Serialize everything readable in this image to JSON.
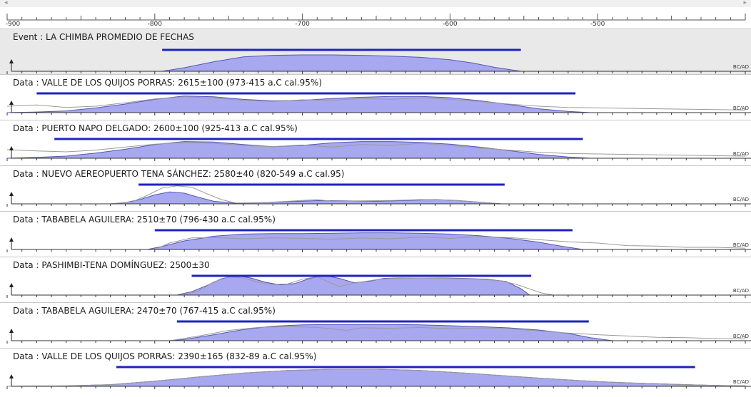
{
  "scrollbar": {
    "left_arrow": "◂",
    "right_arrow": "▸"
  },
  "axis": {
    "min": -900,
    "max": -400,
    "labels": [
      {
        "value": -900,
        "text": "-900"
      },
      {
        "value": -800,
        "text": "-800"
      },
      {
        "value": -700,
        "text": "-700"
      },
      {
        "value": -600,
        "text": "-600"
      },
      {
        "value": -500,
        "text": "-500"
      }
    ],
    "unit_label": "BC/AD"
  },
  "colors": {
    "range_bar": "#1f22c0",
    "posterior_fill": "#a7a8ef",
    "posterior_stroke": "#5656b3",
    "prior_line": "#9a9a9a",
    "event_bg": "#e9e9e9"
  },
  "panels": [
    {
      "label": "Event : LA CHIMBA PROMEDIO DE FECHAS",
      "range": [
        -795,
        -552
      ],
      "posterior": [
        [
          -795,
          0.0
        ],
        [
          -780,
          0.18
        ],
        [
          -760,
          0.48
        ],
        [
          -740,
          0.72
        ],
        [
          -720,
          0.8
        ],
        [
          -700,
          0.82
        ],
        [
          -680,
          0.82
        ],
        [
          -660,
          0.8
        ],
        [
          -640,
          0.76
        ],
        [
          -620,
          0.7
        ],
        [
          -600,
          0.58
        ],
        [
          -585,
          0.42
        ],
        [
          -570,
          0.2
        ],
        [
          -552,
          0.0
        ]
      ],
      "prior": [
        [
          -900,
          0.0
        ],
        [
          -800,
          0.0
        ],
        [
          -560,
          0.0
        ],
        [
          -540,
          0.0
        ],
        [
          -500,
          0.0
        ],
        [
          -400,
          0.0
        ]
      ]
    },
    {
      "label": "Data : VALLE DE LOS QUIJOS PORRAS: 2615±100 (973-415 a.C cal.95%)",
      "range": [
        -880,
        -515
      ],
      "posterior": [
        [
          -900,
          0.0
        ],
        [
          -880,
          0.03
        ],
        [
          -860,
          0.08
        ],
        [
          -840,
          0.22
        ],
        [
          -820,
          0.4
        ],
        [
          -800,
          0.62
        ],
        [
          -780,
          0.78
        ],
        [
          -760,
          0.74
        ],
        [
          -740,
          0.62
        ],
        [
          -720,
          0.55
        ],
        [
          -700,
          0.58
        ],
        [
          -680,
          0.66
        ],
        [
          -660,
          0.72
        ],
        [
          -640,
          0.76
        ],
        [
          -620,
          0.76
        ],
        [
          -600,
          0.7
        ],
        [
          -580,
          0.56
        ],
        [
          -560,
          0.38
        ],
        [
          -540,
          0.18
        ],
        [
          -520,
          0.06
        ],
        [
          -505,
          0.0
        ]
      ],
      "prior": [
        [
          -900,
          0.3
        ],
        [
          -880,
          0.36
        ],
        [
          -860,
          0.24
        ],
        [
          -840,
          0.3
        ],
        [
          -820,
          0.46
        ],
        [
          -800,
          0.64
        ],
        [
          -780,
          0.74
        ],
        [
          -760,
          0.68
        ],
        [
          -740,
          0.58
        ],
        [
          -720,
          0.52
        ],
        [
          -700,
          0.6
        ],
        [
          -680,
          0.58
        ],
        [
          -660,
          0.66
        ],
        [
          -640,
          0.62
        ],
        [
          -620,
          0.7
        ],
        [
          -600,
          0.62
        ],
        [
          -580,
          0.52
        ],
        [
          -560,
          0.4
        ],
        [
          -540,
          0.3
        ],
        [
          -520,
          0.24
        ],
        [
          -500,
          0.22
        ],
        [
          -460,
          0.18
        ],
        [
          -420,
          0.14
        ],
        [
          -400,
          0.12
        ]
      ]
    },
    {
      "label": "Data : PUERTO NAPO DELGADO: 2600±100 (925-413 a.C cal.95%)",
      "range": [
        -868,
        -510
      ],
      "posterior": [
        [
          -900,
          0.0
        ],
        [
          -880,
          0.04
        ],
        [
          -860,
          0.1
        ],
        [
          -840,
          0.24
        ],
        [
          -820,
          0.42
        ],
        [
          -800,
          0.64
        ],
        [
          -780,
          0.78
        ],
        [
          -760,
          0.76
        ],
        [
          -740,
          0.64
        ],
        [
          -720,
          0.54
        ],
        [
          -700,
          0.6
        ],
        [
          -680,
          0.72
        ],
        [
          -660,
          0.78
        ],
        [
          -640,
          0.78
        ],
        [
          -620,
          0.74
        ],
        [
          -600,
          0.66
        ],
        [
          -580,
          0.52
        ],
        [
          -560,
          0.36
        ],
        [
          -540,
          0.18
        ],
        [
          -520,
          0.06
        ],
        [
          -505,
          0.0
        ]
      ],
      "prior": [
        [
          -900,
          0.4
        ],
        [
          -880,
          0.34
        ],
        [
          -860,
          0.3
        ],
        [
          -840,
          0.38
        ],
        [
          -820,
          0.52
        ],
        [
          -800,
          0.66
        ],
        [
          -780,
          0.74
        ],
        [
          -760,
          0.7
        ],
        [
          -740,
          0.6
        ],
        [
          -720,
          0.54
        ],
        [
          -700,
          0.62
        ],
        [
          -680,
          0.52
        ],
        [
          -660,
          0.64
        ],
        [
          -640,
          0.6
        ],
        [
          -620,
          0.7
        ],
        [
          -600,
          0.6
        ],
        [
          -580,
          0.48
        ],
        [
          -560,
          0.38
        ],
        [
          -540,
          0.28
        ],
        [
          -520,
          0.22
        ],
        [
          -500,
          0.2
        ],
        [
          -460,
          0.16
        ],
        [
          -420,
          0.12
        ],
        [
          -400,
          0.1
        ]
      ]
    },
    {
      "label": "Data : NUEVO AEREOPUERTO TENA SÁNCHEZ: 2580±40 (820-549 a.C cal.95)",
      "range": [
        -811,
        -563
      ],
      "posterior": [
        [
          -830,
          0.0
        ],
        [
          -820,
          0.06
        ],
        [
          -810,
          0.2
        ],
        [
          -800,
          0.42
        ],
        [
          -790,
          0.56
        ],
        [
          -780,
          0.5
        ],
        [
          -770,
          0.3
        ],
        [
          -760,
          0.12
        ],
        [
          -745,
          0.03
        ],
        [
          -730,
          0.05
        ],
        [
          -710,
          0.1
        ],
        [
          -690,
          0.15
        ],
        [
          -670,
          0.14
        ],
        [
          -650,
          0.12
        ],
        [
          -630,
          0.16
        ],
        [
          -610,
          0.2
        ],
        [
          -595,
          0.16
        ],
        [
          -580,
          0.08
        ],
        [
          -565,
          0.0
        ]
      ],
      "prior": [
        [
          -830,
          0.0
        ],
        [
          -815,
          0.1
        ],
        [
          -805,
          0.4
        ],
        [
          -795,
          0.74
        ],
        [
          -785,
          0.84
        ],
        [
          -775,
          0.78
        ],
        [
          -765,
          0.48
        ],
        [
          -755,
          0.2
        ],
        [
          -745,
          0.04
        ],
        [
          -730,
          0.04
        ],
        [
          -710,
          0.12
        ],
        [
          -690,
          0.2
        ],
        [
          -680,
          0.12
        ],
        [
          -660,
          0.14
        ],
        [
          -640,
          0.16
        ],
        [
          -620,
          0.2
        ],
        [
          -600,
          0.18
        ],
        [
          -585,
          0.1
        ],
        [
          -565,
          0.0
        ]
      ]
    },
    {
      "label": "Data : TABABELA AGUILERA: 2510±70 (796-430 a.C cal.95%)",
      "range": [
        -800,
        -517
      ],
      "posterior": [
        [
          -805,
          0.0
        ],
        [
          -795,
          0.14
        ],
        [
          -780,
          0.4
        ],
        [
          -760,
          0.62
        ],
        [
          -740,
          0.72
        ],
        [
          -720,
          0.74
        ],
        [
          -700,
          0.74
        ],
        [
          -680,
          0.76
        ],
        [
          -660,
          0.78
        ],
        [
          -640,
          0.78
        ],
        [
          -620,
          0.76
        ],
        [
          -600,
          0.72
        ],
        [
          -580,
          0.64
        ],
        [
          -560,
          0.52
        ],
        [
          -540,
          0.34
        ],
        [
          -525,
          0.16
        ],
        [
          -510,
          0.0
        ]
      ],
      "prior": [
        [
          -800,
          0.0
        ],
        [
          -790,
          0.3
        ],
        [
          -775,
          0.54
        ],
        [
          -760,
          0.56
        ],
        [
          -740,
          0.5
        ],
        [
          -720,
          0.54
        ],
        [
          -700,
          0.52
        ],
        [
          -680,
          0.48
        ],
        [
          -660,
          0.54
        ],
        [
          -640,
          0.5
        ],
        [
          -620,
          0.58
        ],
        [
          -600,
          0.52
        ],
        [
          -580,
          0.6
        ],
        [
          -560,
          0.56
        ],
        [
          -540,
          0.46
        ],
        [
          -520,
          0.36
        ],
        [
          -500,
          0.3
        ],
        [
          -480,
          0.18
        ],
        [
          -460,
          0.16
        ],
        [
          -440,
          0.1
        ],
        [
          -420,
          0.1
        ],
        [
          -400,
          0.06
        ]
      ]
    },
    {
      "label": "Data : PASHIMBI-TENA DOMÍNGUEZ: 2500±30",
      "range": [
        -775,
        -545
      ],
      "posterior": [
        [
          -785,
          0.0
        ],
        [
          -775,
          0.16
        ],
        [
          -765,
          0.44
        ],
        [
          -755,
          0.76
        ],
        [
          -745,
          0.92
        ],
        [
          -735,
          0.8
        ],
        [
          -725,
          0.6
        ],
        [
          -715,
          0.48
        ],
        [
          -705,
          0.54
        ],
        [
          -695,
          0.78
        ],
        [
          -685,
          0.92
        ],
        [
          -675,
          0.78
        ],
        [
          -665,
          0.58
        ],
        [
          -655,
          0.64
        ],
        [
          -645,
          0.78
        ],
        [
          -635,
          0.8
        ],
        [
          -620,
          0.8
        ],
        [
          -605,
          0.8
        ],
        [
          -590,
          0.78
        ],
        [
          -575,
          0.74
        ],
        [
          -562,
          0.64
        ],
        [
          -552,
          0.3
        ],
        [
          -546,
          0.0
        ]
      ],
      "prior": [
        [
          -780,
          0.0
        ],
        [
          -770,
          0.2
        ],
        [
          -760,
          0.62
        ],
        [
          -750,
          0.84
        ],
        [
          -740,
          0.8
        ],
        [
          -730,
          0.6
        ],
        [
          -720,
          0.5
        ],
        [
          -710,
          0.52
        ],
        [
          -700,
          0.74
        ],
        [
          -690,
          0.86
        ],
        [
          -682,
          0.6
        ],
        [
          -675,
          0.4
        ],
        [
          -665,
          0.56
        ],
        [
          -650,
          0.72
        ],
        [
          -640,
          0.78
        ],
        [
          -620,
          0.8
        ],
        [
          -600,
          0.78
        ],
        [
          -580,
          0.74
        ],
        [
          -565,
          0.66
        ],
        [
          -555,
          0.5
        ],
        [
          -545,
          0.26
        ],
        [
          -538,
          0.1
        ],
        [
          -530,
          0.0
        ]
      ]
    },
    {
      "label": "Data : TABABELA AGUILERA: 2470±70 (767-415 a.C cal.95%)",
      "range": [
        -785,
        -506
      ],
      "posterior": [
        [
          -790,
          0.0
        ],
        [
          -780,
          0.06
        ],
        [
          -760,
          0.28
        ],
        [
          -740,
          0.52
        ],
        [
          -720,
          0.68
        ],
        [
          -700,
          0.74
        ],
        [
          -680,
          0.76
        ],
        [
          -660,
          0.76
        ],
        [
          -640,
          0.76
        ],
        [
          -620,
          0.74
        ],
        [
          -600,
          0.7
        ],
        [
          -580,
          0.66
        ],
        [
          -560,
          0.6
        ],
        [
          -540,
          0.5
        ],
        [
          -520,
          0.34
        ],
        [
          -505,
          0.14
        ],
        [
          -490,
          0.0
        ]
      ],
      "prior": [
        [
          -790,
          0.0
        ],
        [
          -770,
          0.22
        ],
        [
          -750,
          0.48
        ],
        [
          -730,
          0.62
        ],
        [
          -710,
          0.66
        ],
        [
          -690,
          0.62
        ],
        [
          -670,
          0.48
        ],
        [
          -660,
          0.6
        ],
        [
          -640,
          0.58
        ],
        [
          -620,
          0.62
        ],
        [
          -600,
          0.56
        ],
        [
          -580,
          0.6
        ],
        [
          -560,
          0.56
        ],
        [
          -540,
          0.46
        ],
        [
          -520,
          0.36
        ],
        [
          -500,
          0.28
        ],
        [
          -480,
          0.22
        ],
        [
          -460,
          0.16
        ],
        [
          -440,
          0.14
        ],
        [
          -420,
          0.1
        ],
        [
          -400,
          0.08
        ]
      ]
    },
    {
      "label": "Data : VALLE DE LOS QUIJOS PORRAS: 2390±165 (832-89 a.C cal.95%)",
      "range": [
        -826,
        -434
      ],
      "posterior": [
        [
          -900,
          0.0
        ],
        [
          -860,
          0.02
        ],
        [
          -830,
          0.08
        ],
        [
          -800,
          0.24
        ],
        [
          -770,
          0.44
        ],
        [
          -740,
          0.62
        ],
        [
          -710,
          0.74
        ],
        [
          -680,
          0.8
        ],
        [
          -650,
          0.8
        ],
        [
          -620,
          0.74
        ],
        [
          -590,
          0.62
        ],
        [
          -560,
          0.48
        ],
        [
          -530,
          0.34
        ],
        [
          -500,
          0.22
        ],
        [
          -470,
          0.14
        ],
        [
          -440,
          0.08
        ],
        [
          -420,
          0.04
        ],
        [
          -400,
          0.02
        ]
      ],
      "prior": [
        [
          -900,
          0.0
        ],
        [
          -860,
          0.02
        ],
        [
          -830,
          0.08
        ],
        [
          -800,
          0.24
        ],
        [
          -770,
          0.44
        ],
        [
          -740,
          0.62
        ],
        [
          -710,
          0.74
        ],
        [
          -680,
          0.8
        ],
        [
          -650,
          0.8
        ],
        [
          -620,
          0.74
        ],
        [
          -590,
          0.62
        ],
        [
          -560,
          0.48
        ],
        [
          -530,
          0.34
        ],
        [
          -500,
          0.22
        ],
        [
          -470,
          0.14
        ],
        [
          -440,
          0.08
        ],
        [
          -420,
          0.04
        ],
        [
          -400,
          0.02
        ]
      ]
    }
  ]
}
